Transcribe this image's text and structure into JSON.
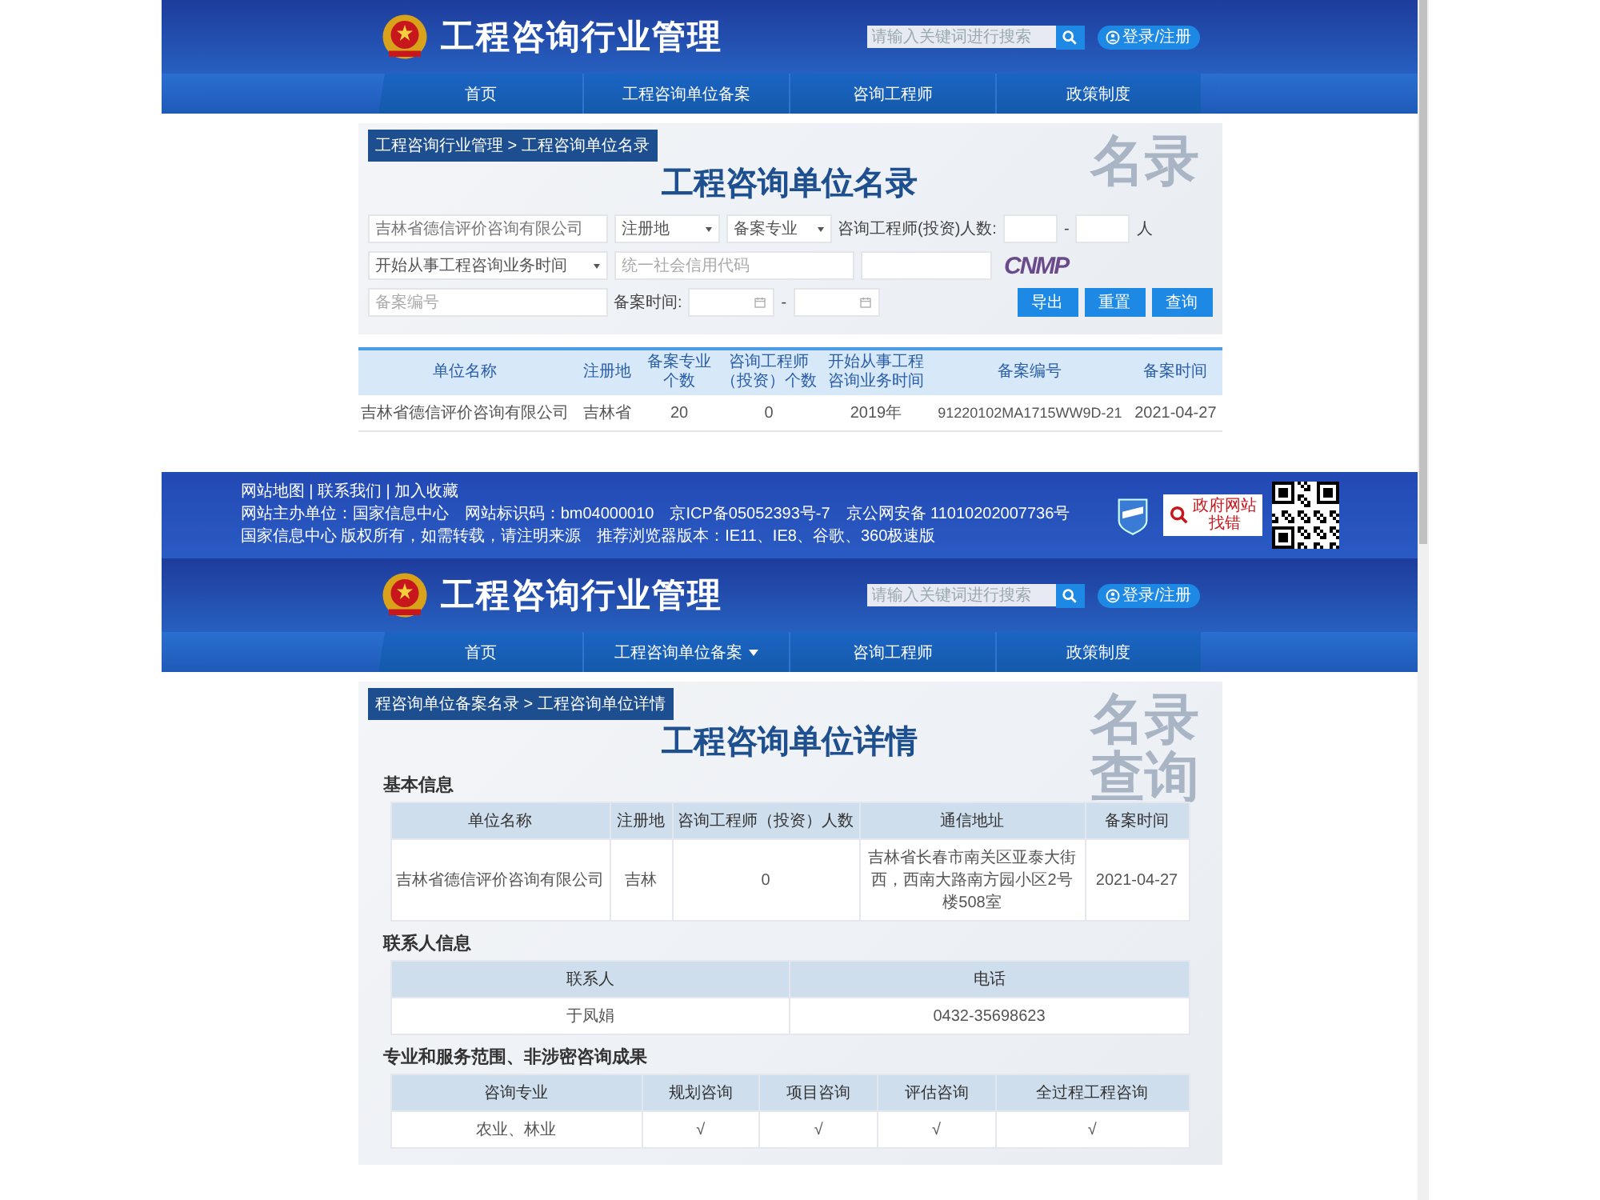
{
  "list_page": {
    "header": {
      "site_title": "工程咨询行业管理",
      "search": {
        "placeholder": "请输入关键词进行搜索"
      },
      "login": "登录/注册"
    },
    "nav": [
      {
        "label": "首页",
        "has_menu": false
      },
      {
        "label": "工程咨询单位备案",
        "has_menu": false
      },
      {
        "label": "咨询工程师",
        "has_menu": false
      },
      {
        "label": "政策制度",
        "has_menu": false
      }
    ],
    "breadcrumb": "工程咨询行业管理 > 工程咨询单位名录",
    "title": "工程咨询单位名录",
    "backdrop_text": [
      "名录"
    ],
    "form_rows": [
      [
        {
          "kind": "field",
          "value": "吉林省德信评价咨询有限公司"
        },
        {
          "kind": "select",
          "value": "注册地"
        },
        {
          "kind": "select",
          "value": "备案专业"
        },
        {
          "kind": "label",
          "text": "咨询工程师(投资)人数:"
        },
        {
          "kind": "field"
        },
        {
          "kind": "label",
          "text": "-"
        },
        {
          "kind": "field"
        },
        {
          "kind": "label",
          "text": "人"
        }
      ],
      [
        {
          "kind": "select",
          "value": "开始从事工程咨询业务时间"
        },
        {
          "kind": "field",
          "placeholder": "统一社会信用代码"
        },
        {
          "kind": "field"
        },
        {
          "kind": "captcha",
          "text": "CNMP"
        }
      ],
      [
        {
          "kind": "field",
          "placeholder": "备案编号"
        },
        {
          "kind": "label",
          "text": "备案时间:"
        },
        {
          "kind": "date"
        },
        {
          "kind": "label",
          "text": "-"
        },
        {
          "kind": "date"
        },
        {
          "kind": "spacer"
        },
        {
          "kind": "button",
          "label": "导出"
        },
        {
          "kind": "button",
          "label": "重置"
        },
        {
          "kind": "button",
          "label": "查询"
        }
      ]
    ],
    "table": {
      "columns": [
        "单位名称",
        "注册地",
        "备案专业个数",
        "咨询工程师（投资）个数",
        "开始从事工程咨询业务时间",
        "备案编号",
        "备案时间"
      ],
      "rows": [
        [
          "吉林省德信评价咨询有限公司",
          "吉林省",
          "20",
          "0",
          "2019年",
          "91220102MA1715WW9D-21",
          "2021-04-27"
        ]
      ]
    }
  },
  "footer": {
    "links": "网站地图 | 联系我们 | 加入收藏",
    "lines": [
      "网站主办单位：国家信息中心　网站标识码：bm04000010　京ICP备05052393号-7　京公网安备 11010202007736号",
      "国家信息中心 版权所有，如需转载，请注明来源　推荐浏览器版本：IE11、IE8、谷歌、360极速版"
    ],
    "badge_text": "政府网站",
    "badge_subtext": "找错"
  },
  "detail_page": {
    "header": {
      "site_title": "工程咨询行业管理",
      "search": {
        "placeholder": "请输入关键词进行搜索"
      },
      "login": "登录/注册"
    },
    "nav": [
      {
        "label": "首页",
        "has_menu": false
      },
      {
        "label": "工程咨询单位备案",
        "has_menu": true
      },
      {
        "label": "咨询工程师",
        "has_menu": false
      },
      {
        "label": "政策制度",
        "has_menu": false
      }
    ],
    "breadcrumb": "程咨询单位备案名录 > 工程咨询单位详情",
    "title": "工程咨询单位详情",
    "backdrop_text": [
      "名录",
      "查询"
    ],
    "sections": [
      {
        "heading": "基本信息",
        "columns": [
          "单位名称",
          "注册地",
          "咨询工程师（投资）人数",
          "通信地址",
          "备案时间"
        ],
        "rows": [
          [
            "吉林省德信评价咨询有限公司",
            "吉林",
            "0",
            "吉林省长春市南关区亚泰大街西，西南大路南方园小区2号楼508室",
            "2021-04-27"
          ]
        ]
      },
      {
        "heading": "联系人信息",
        "columns": [
          "联系人",
          "电话"
        ],
        "rows": [
          [
            "于凤娟",
            "0432-35698623"
          ]
        ]
      },
      {
        "heading": "专业和服务范围、非涉密咨询成果",
        "columns": [
          "咨询专业",
          "规划咨询",
          "项目咨询",
          "评估咨询",
          "全过程工程咨询"
        ],
        "rows": [
          [
            "农业、林业",
            "√",
            "√",
            "√",
            "√"
          ]
        ]
      }
    ]
  }
}
